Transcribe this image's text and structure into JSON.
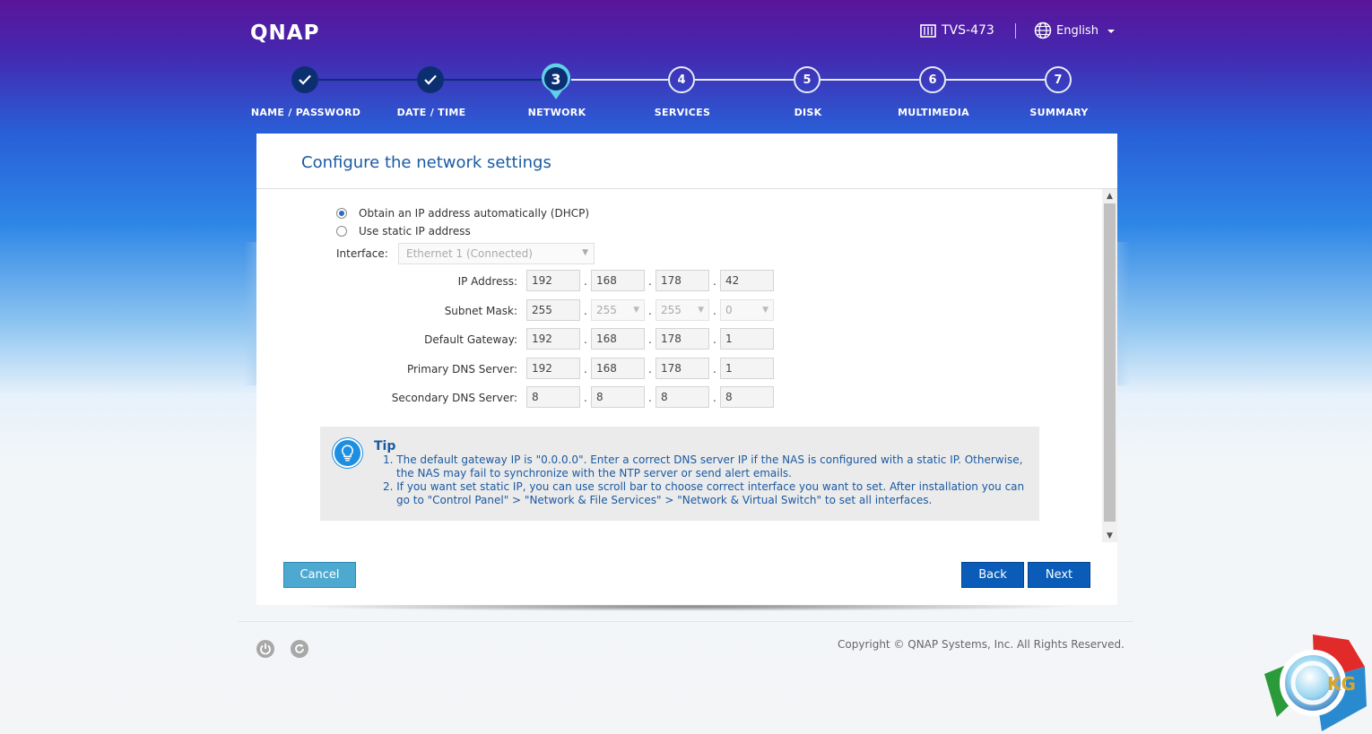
{
  "header": {
    "logo": "QNAP",
    "model": "TVS-473",
    "language": "English"
  },
  "steps": [
    {
      "number": "1",
      "label": "NAME / PASSWORD",
      "state": "done"
    },
    {
      "number": "2",
      "label": "DATE / TIME",
      "state": "done"
    },
    {
      "number": "3",
      "label": "NETWORK",
      "state": "current"
    },
    {
      "number": "4",
      "label": "SERVICES",
      "state": "todo"
    },
    {
      "number": "5",
      "label": "DISK",
      "state": "todo"
    },
    {
      "number": "6",
      "label": "MULTIMEDIA",
      "state": "todo"
    },
    {
      "number": "7",
      "label": "SUMMARY",
      "state": "todo"
    }
  ],
  "panel": {
    "title": "Configure the network settings",
    "radio_dhcp": "Obtain an IP address automatically (DHCP)",
    "radio_static": "Use static IP address",
    "selected_mode": "dhcp",
    "interface_label": "Interface:",
    "interface_value": "Ethernet 1 (Connected)",
    "fields": [
      {
        "label": "IP Address:",
        "octets": [
          "192",
          "168",
          "178",
          "42"
        ]
      },
      {
        "label": "Subnet Mask:",
        "octets": [
          "255",
          "255",
          "255",
          "0"
        ]
      },
      {
        "label": "Default Gateway:",
        "octets": [
          "192",
          "168",
          "178",
          "1"
        ]
      },
      {
        "label": "Primary DNS Server:",
        "octets": [
          "192",
          "168",
          "178",
          "1"
        ]
      },
      {
        "label": "Secondary DNS Server:",
        "octets": [
          "8",
          "8",
          "8",
          "8"
        ]
      }
    ],
    "tip": {
      "title": "Tip",
      "lines": [
        "1. The default gateway IP is \"0.0.0.0\". Enter a correct DNS server IP if the NAS is configured with a static IP. Otherwise,",
        "the NAS may fail to synchronize with the NTP server or send alert emails.",
        "2. If you want set static IP, you can use scroll bar to choose correct interface you want to set. After installation you can",
        "go to \"Control Panel\" > \"Network & File Services\" > \"Network & Virtual Switch\" to set all interfaces."
      ]
    },
    "buttons": {
      "cancel": "Cancel",
      "back": "Back",
      "next": "Next"
    }
  },
  "footer": {
    "copyright": "Copyright © QNAP Systems, Inc. All Rights Reserved.",
    "icons": [
      "power-icon",
      "restart-icon"
    ]
  },
  "watermark": {
    "text": "KG"
  },
  "colors": {
    "accent": "#0a5cb8",
    "title": "#1b5aa3",
    "step_done": "#0c2f72"
  }
}
